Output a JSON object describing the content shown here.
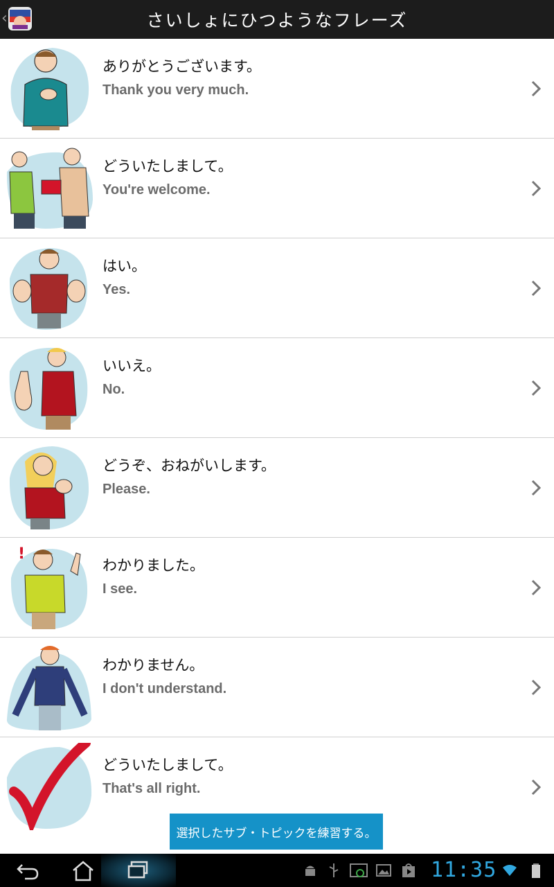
{
  "topbar": {
    "title": "さいしょにひつようなフレーズ",
    "icon_name": "app-icon"
  },
  "phrases": [
    {
      "jp": "ありがとうございます。",
      "en": "Thank you very much."
    },
    {
      "jp": "どういたしまして。",
      "en": "You're welcome."
    },
    {
      "jp": "はい。",
      "en": "Yes."
    },
    {
      "jp": "いいえ。",
      "en": "No."
    },
    {
      "jp": "どうぞ、おねがいします。",
      "en": "Please."
    },
    {
      "jp": "わかりました。",
      "en": "I see."
    },
    {
      "jp": "わかりません。",
      "en": "I don't understand."
    },
    {
      "jp": "どういたしまして。",
      "en": "That's all right."
    }
  ],
  "practice_button": {
    "label": "選択したサブ・トピックを練習する。"
  },
  "system_bar": {
    "time": "11:35",
    "accent": "#31a8e0"
  },
  "colors": {
    "topbar": "#1c1c1c",
    "button": "#1592c8",
    "illustration_bg": "#c5e3ec"
  }
}
